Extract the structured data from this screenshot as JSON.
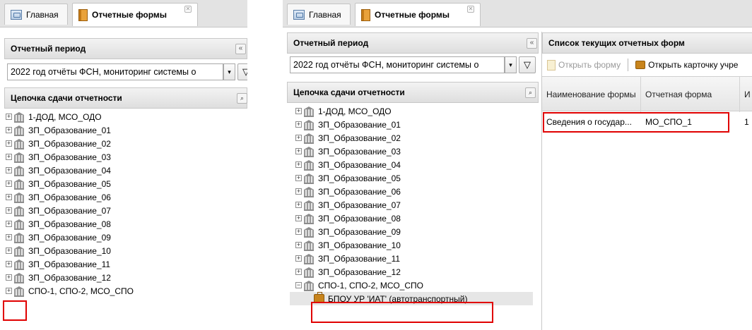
{
  "tabs": {
    "home": "Главная",
    "reports": "Отчетные формы"
  },
  "period_panel": {
    "title": "Отчетный период",
    "collapse": "«",
    "selected": "2022 год отчёты ФСН, мониторинг системы о",
    "dropdown_arrow": "▾",
    "filter_icon": "▽"
  },
  "chain_panel": {
    "title": "Цепочка сдачи отчетности",
    "find_icon": "binoculars",
    "nodes": [
      "1-ДОД, МСО_ОДО",
      "ЗП_Образование_01",
      "ЗП_Образование_02",
      "ЗП_Образование_03",
      "ЗП_Образование_04",
      "ЗП_Образование_05",
      "ЗП_Образование_06",
      "ЗП_Образование_07",
      "ЗП_Образование_08",
      "ЗП_Образование_09",
      "ЗП_Образование_10",
      "ЗП_Образование_11",
      "ЗП_Образование_12",
      "СПО-1, СПО-2, МСО_СПО"
    ],
    "child_node": "БПОУ УР 'ИАТ' (автотранспортный)",
    "expand_symbol": "+",
    "collapse_symbol": "−"
  },
  "forms_panel": {
    "title": "Список текущих отчетных форм",
    "open_form": "Открыть форму",
    "open_card": "Открыть карточку учре",
    "columns": [
      "Наименование формы",
      "Отчетная форма",
      "И"
    ],
    "rows": [
      {
        "name": "Сведения о государ...",
        "form": "МО_СПО_1",
        "extra": "1"
      }
    ]
  },
  "colors": {
    "highlight": "#e00000",
    "selected_row": "#e6e6e6"
  }
}
